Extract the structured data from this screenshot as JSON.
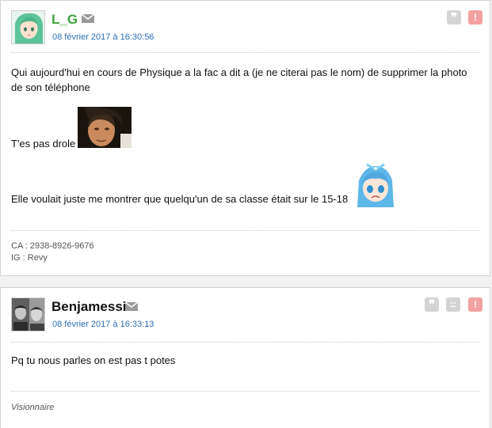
{
  "posts": [
    {
      "author": "L_G",
      "author_color": "#3f9f3f",
      "date": "08 février 2017 à 16:30:56",
      "lines": [
        "Qui aujourd'hui en cours de Physique a la fac a dit a (je ne citerai pas le nom) de supprimer la photo",
        "de son téléphone",
        "T'es pas drole",
        "Elle voulait juste me montrer que quelqu'un de sa classe était sur le 15-18"
      ],
      "signature": [
        "CA : 2938-8926-9676",
        "IG : Revy"
      ],
      "icons": [
        "mail-icon",
        "quote-icon",
        "report-icon"
      ]
    },
    {
      "author": "Benjamessi",
      "author_color": "#111111",
      "date": "08 février 2017 à 16:33:13",
      "lines": [
        "Pq tu nous parles on est pas t potes"
      ],
      "signature": [
        "Visionnaire"
      ],
      "icons": [
        "mail-icon",
        "quote-icon",
        "smiley-icon",
        "report-icon"
      ]
    }
  ],
  "colors": {
    "date": "#2b6fb6",
    "report": "#f3a0a0",
    "quote": "#d4d4d4"
  }
}
